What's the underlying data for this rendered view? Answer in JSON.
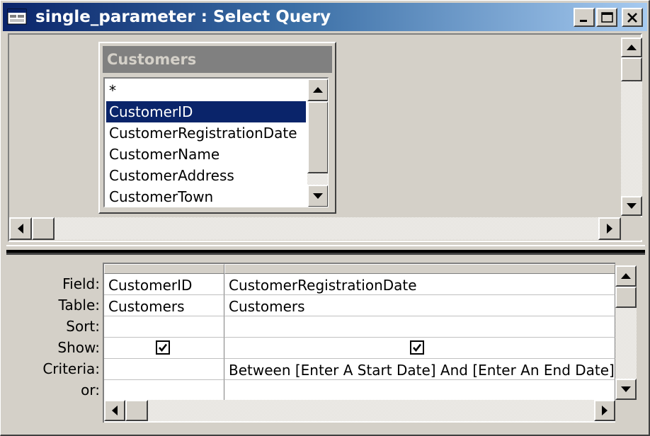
{
  "window": {
    "title": "single_parameter : Select Query",
    "icons": {
      "app": "query-window-icon",
      "minimize": "minimize-icon",
      "maximize": "maximize-icon",
      "close": "close-icon"
    }
  },
  "field_list": {
    "title": "Customers",
    "items": [
      {
        "label": "*",
        "selected": false
      },
      {
        "label": "CustomerID",
        "selected": true
      },
      {
        "label": "CustomerRegistrationDate",
        "selected": false
      },
      {
        "label": "CustomerName",
        "selected": false
      },
      {
        "label": "CustomerAddress",
        "selected": false
      },
      {
        "label": "CustomerTown",
        "selected": false
      }
    ]
  },
  "qbe_grid": {
    "row_labels": {
      "field": "Field:",
      "table": "Table:",
      "sort": "Sort:",
      "show": "Show:",
      "criteria": "Criteria:",
      "or": "or:"
    },
    "columns": [
      {
        "field": "CustomerID",
        "table": "Customers",
        "sort": "",
        "show": true,
        "criteria": "",
        "or": ""
      },
      {
        "field": "CustomerRegistrationDate",
        "table": "Customers",
        "sort": "",
        "show": true,
        "criteria": "Between [Enter A Start Date] And [Enter An End Date]",
        "or": ""
      }
    ]
  },
  "colors": {
    "title_bar_start": "#0a246a",
    "title_bar_end": "#a6caf0",
    "selection": "#0a246a",
    "face": "#d4d0c8"
  }
}
